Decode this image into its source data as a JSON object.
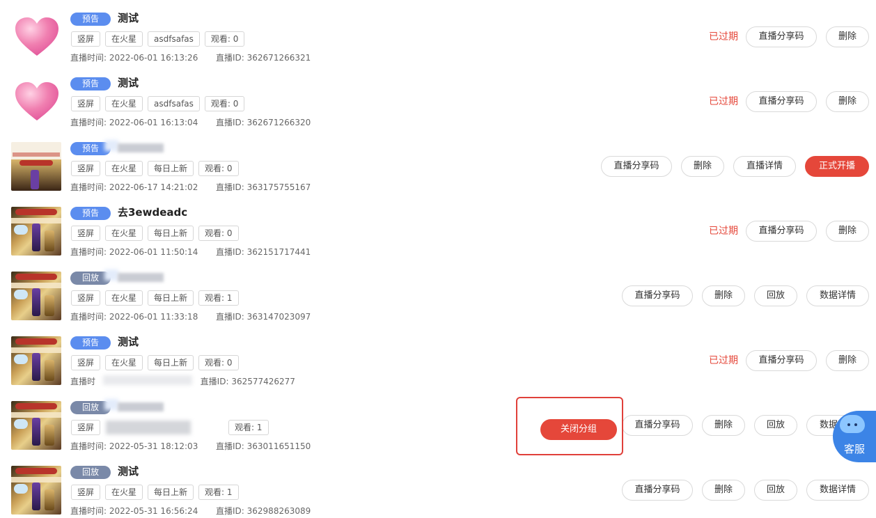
{
  "rows": [
    {
      "thumb": "heart",
      "type_label": "预告",
      "type_style": "preview",
      "title": "测试",
      "title_hidden": false,
      "chips": [
        "竖屏",
        "在火星",
        "asdfsafas",
        "观看: 0"
      ],
      "meta": {
        "time_label": "直播时间:",
        "time": "2022-06-01 16:13:26",
        "id_label": "直播ID:",
        "id": "362671266321"
      },
      "actions": [
        {
          "kind": "expired",
          "label": "已过期"
        },
        {
          "kind": "share",
          "label": "直播分享码"
        },
        {
          "kind": "del",
          "label": "删除"
        }
      ]
    },
    {
      "thumb": "heart",
      "type_label": "预告",
      "type_style": "preview",
      "title": "测试",
      "title_hidden": false,
      "chips": [
        "竖屏",
        "在火星",
        "asdfsafas",
        "观看: 0"
      ],
      "meta": {
        "time_label": "直播时间:",
        "time": "2022-06-01 16:13:04",
        "id_label": "直播ID:",
        "id": "362671266320"
      },
      "actions": [
        {
          "kind": "expired",
          "label": "已过期"
        },
        {
          "kind": "share",
          "label": "直播分享码"
        },
        {
          "kind": "del",
          "label": "删除"
        }
      ]
    },
    {
      "thumb": "loreal",
      "type_label": "预告",
      "type_style": "preview",
      "title": "",
      "title_hidden": true,
      "chips": [
        "竖屏",
        "在火星",
        "每日上新",
        "观看: 0"
      ],
      "meta": {
        "time_label": "直播时间:",
        "time": "2022-06-17 14:21:02",
        "id_label": "直播ID:",
        "id": "363175755167"
      },
      "actions": [
        {
          "kind": "share",
          "label": "直播分享码"
        },
        {
          "kind": "del",
          "label": "删除"
        },
        {
          "kind": "detail",
          "label": "直播详情"
        },
        {
          "kind": "live",
          "label": "正式开播"
        }
      ]
    },
    {
      "thumb": "product",
      "type_label": "预告",
      "type_style": "preview",
      "title": "去3ewdeadc",
      "title_hidden": false,
      "chips": [
        "竖屏",
        "在火星",
        "每日上新",
        "观看: 0"
      ],
      "meta": {
        "time_label": "直播时间:",
        "time": "2022-06-01 11:50:14",
        "id_label": "直播ID:",
        "id": "362151717441"
      },
      "actions": [
        {
          "kind": "expired",
          "label": "已过期"
        },
        {
          "kind": "share",
          "label": "直播分享码"
        },
        {
          "kind": "del",
          "label": "删除"
        }
      ]
    },
    {
      "thumb": "product",
      "type_label": "回放",
      "type_style": "replay",
      "title": "",
      "title_hidden": true,
      "chips": [
        "竖屏",
        "在火星",
        "每日上新",
        "观看: 1"
      ],
      "meta": {
        "time_label": "直播时间:",
        "time": "2022-06-01 11:33:18",
        "id_label": "直播ID:",
        "id": "363147023097"
      },
      "actions": [
        {
          "kind": "share",
          "label": "直播分享码"
        },
        {
          "kind": "del",
          "label": "删除"
        },
        {
          "kind": "replay",
          "label": "回放"
        },
        {
          "kind": "data",
          "label": "数据详情"
        }
      ]
    },
    {
      "thumb": "product",
      "type_label": "预告",
      "type_style": "preview",
      "title": "测试",
      "title_hidden": false,
      "chips": [
        "竖屏",
        "在火星",
        "每日上新",
        "观看: 0"
      ],
      "meta": {
        "time_label": "直播时",
        "time": "",
        "id_label": "直播ID:",
        "id": "362577426277",
        "time_blurred": true
      },
      "actions": [
        {
          "kind": "expired",
          "label": "已过期"
        },
        {
          "kind": "share",
          "label": "直播分享码"
        },
        {
          "kind": "del",
          "label": "删除"
        }
      ]
    },
    {
      "thumb": "product",
      "type_label": "回放",
      "type_style": "replay",
      "title": "",
      "title_hidden": true,
      "chips": [
        "竖屏",
        "观看: 1"
      ],
      "chips_blurred": true,
      "meta": {
        "time_label": "直播时间:",
        "time": "2022-05-31 18:12:03",
        "id_label": "直播ID:",
        "id": "363011651150"
      },
      "actions": [
        {
          "kind": "share",
          "label": "直播分享码"
        },
        {
          "kind": "del",
          "label": "删除"
        },
        {
          "kind": "replay",
          "label": "回放"
        },
        {
          "kind": "data",
          "label": "数据详情"
        }
      ]
    },
    {
      "thumb": "product",
      "type_label": "回放",
      "type_style": "replay",
      "title": "测试",
      "title_hidden": false,
      "chips": [
        "竖屏",
        "在火星",
        "每日上新",
        "观看: 1"
      ],
      "meta": {
        "time_label": "直播时间:",
        "time": "2022-05-31 16:56:24",
        "id_label": "直播ID:",
        "id": "362988263089"
      },
      "actions": [
        {
          "kind": "share",
          "label": "直播分享码"
        },
        {
          "kind": "del",
          "label": "删除"
        },
        {
          "kind": "replay",
          "label": "回放"
        },
        {
          "kind": "data",
          "label": "数据详情"
        }
      ]
    }
  ],
  "close_group": {
    "label": "关闭分组"
  },
  "support": {
    "label": "客服"
  },
  "colors": {
    "accent_red": "#e5473a",
    "preview_blue": "#5b8def",
    "replay_gray": "#7a89a8"
  }
}
